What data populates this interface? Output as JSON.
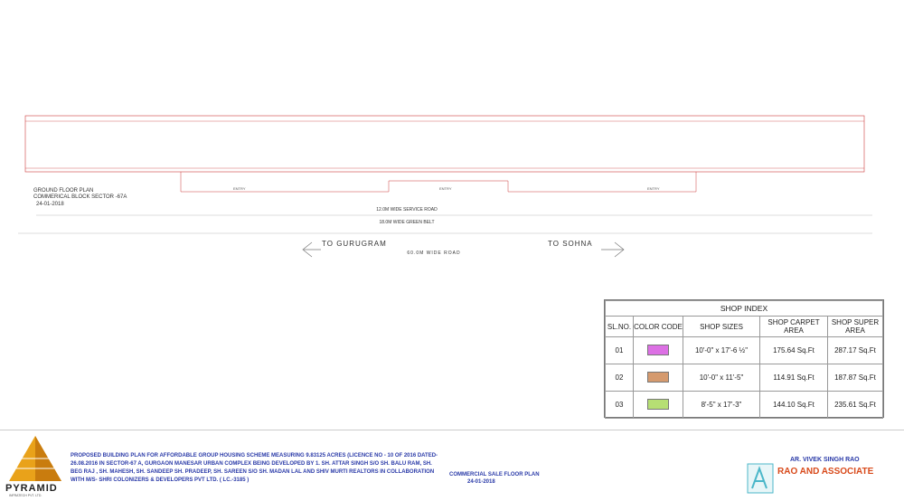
{
  "plan": {
    "title_lines": [
      "GROUND FLOOR PLAN",
      "COMMERICAL BLOCK SECTOR -67A"
    ],
    "date": "24-01-2018",
    "service_road": "12.0M WIDE SERVICE ROAD",
    "green_belt": "18.0M WIDE GREEN BELT",
    "main_road": "60.0M WIDE  ROAD",
    "to_left": "TO  GURUGRAM",
    "to_right": "TO  SOHNA",
    "entries": [
      "ENTRY",
      "ENTRY",
      "ENTRY"
    ],
    "colors": {
      "shop_large": "#dc70e4",
      "shop_small": "#d59a6e",
      "shop_corner": "#b6df74",
      "outline": "#cc3a3a"
    }
  },
  "shop_index": {
    "title": "SHOP INDEX",
    "headers": [
      "SL.NO.",
      "COLOR CODE",
      "SHOP SIZES",
      "SHOP CARPET AREA",
      "SHOP SUPER AREA"
    ],
    "rows": [
      {
        "sl": "01",
        "color": "#dc70e4",
        "size": "10'-0\" x 17'-6 ½\"",
        "carpet": "175.64 Sq.Ft",
        "super": "287.17 Sq.Ft"
      },
      {
        "sl": "02",
        "color": "#d59a6e",
        "size": "10'-0\" x 11'-5\"",
        "carpet": "114.91 Sq.Ft",
        "super": "187.87 Sq.Ft"
      },
      {
        "sl": "03",
        "color": "#b6df74",
        "size": "8'-5\" x 17'-3\"",
        "carpet": "144.10 Sq.Ft",
        "super": "235.61 Sq.Ft"
      }
    ]
  },
  "footer": {
    "brand": "PYRAMID",
    "brand_sub": "INFRATECH PVT. LTD.",
    "description": "PROPOSED BUILDING PLAN FOR AFFORDABLE GROUP HOUSING SCHEME MEASURING 9.83125 ACRES (LICENCE NO - 10  OF 2016 DATED-26.08.2016 IN SECTOR-67 A, GURGAON MANESAR URBAN COMPLEX BEING DEVELOPED BY 1. SH. ATTAR SINGH S/O SH. BALU RAM, SH. BEG RAJ , SH. MAHESH, SH.  SANDEEP SH.  PRADEEP, SH. SAREEN S/O SH. MADAN LAL AND SHIV MURTI REALTORS IN COLLABORATION WITH M/S- SHRI COLONIZERS & DEVELOPERS  PVT LTD. ( LC.-3185 )",
    "sale_title": "COMMERCIAL SALE FLOOR PLAN",
    "sale_date": "24-01-2018",
    "architect": "AR. VIVEK SINGH RAO",
    "firm": "RAO AND ASSOCIATE"
  }
}
